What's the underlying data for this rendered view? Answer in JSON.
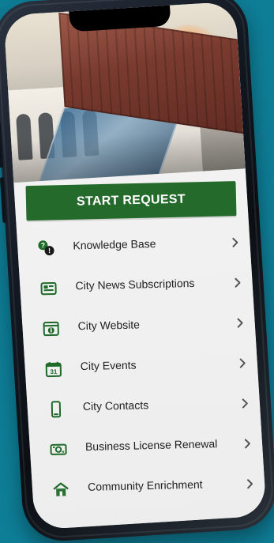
{
  "start_request": {
    "label": "START REQUEST"
  },
  "menu": {
    "items": [
      {
        "label": "Knowledge Base",
        "icon": "help-bubbles-icon"
      },
      {
        "label": "City News Subscriptions",
        "icon": "newspaper-icon"
      },
      {
        "label": "City Website",
        "icon": "info-window-icon"
      },
      {
        "label": "City Events",
        "icon": "calendar-31-icon"
      },
      {
        "label": "City Contacts",
        "icon": "mobile-phone-icon"
      },
      {
        "label": "Business License Renewal",
        "icon": "license-card-icon"
      },
      {
        "label": "Community Enrichment",
        "icon": "home-icon"
      }
    ]
  },
  "colors": {
    "accent_green": "#246b2b",
    "background_teal": "#0e7d96"
  }
}
